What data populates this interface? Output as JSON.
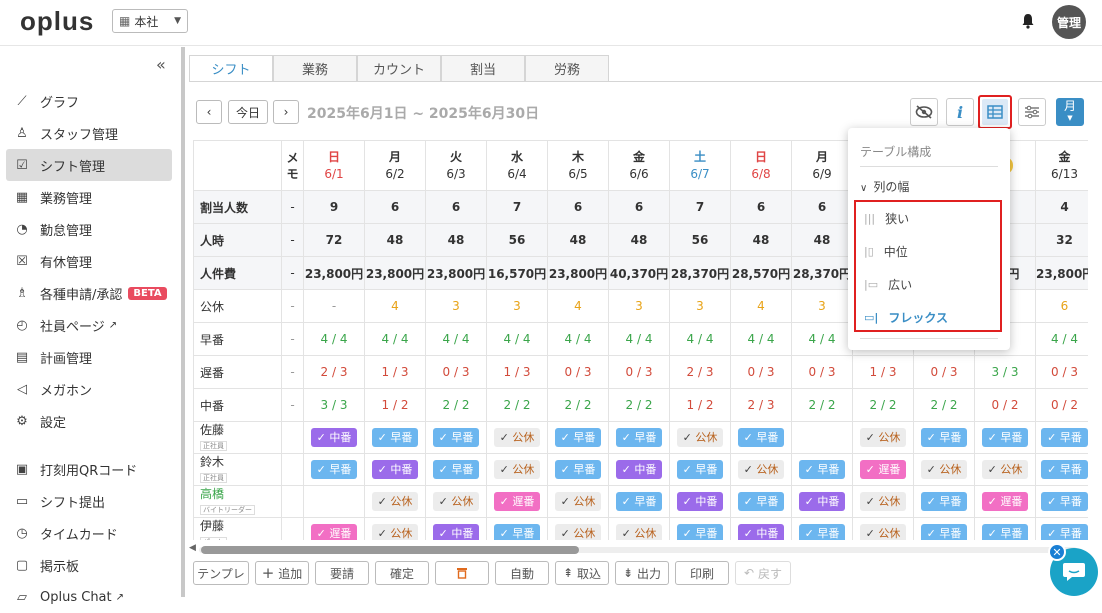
{
  "header": {
    "logo": "oplus",
    "office": "本社",
    "avatar": "管理"
  },
  "sidebar": {
    "items": [
      {
        "label": "グラフ",
        "icon": "chart-icon"
      },
      {
        "label": "スタッフ管理",
        "icon": "person-icon"
      },
      {
        "label": "シフト管理",
        "icon": "calendar-check-icon",
        "active": true
      },
      {
        "label": "業務管理",
        "icon": "calendar-tasks-icon"
      },
      {
        "label": "勤怠管理",
        "icon": "clock-icon"
      },
      {
        "label": "有休管理",
        "icon": "calendar-x-icon"
      },
      {
        "label": "各種申請/承認",
        "icon": "request-icon",
        "badge": "BETA"
      },
      {
        "label": "社員ページ",
        "icon": "stopwatch-icon",
        "external": true
      },
      {
        "label": "計画管理",
        "icon": "plan-icon"
      },
      {
        "label": "メガホン",
        "icon": "megaphone-icon"
      },
      {
        "label": "設定",
        "icon": "gear-icon"
      }
    ],
    "items2": [
      {
        "label": "打刻用QRコード",
        "icon": "qr-icon"
      },
      {
        "label": "シフト提出",
        "icon": "calendar-icon"
      },
      {
        "label": "タイムカード",
        "icon": "timecard-icon"
      },
      {
        "label": "掲示板",
        "icon": "board-icon"
      },
      {
        "label": "Oplus Chat",
        "icon": "chat-icon",
        "external": true
      }
    ]
  },
  "tabs": [
    "シフト",
    "業務",
    "カウント",
    "割当",
    "労務"
  ],
  "nav": {
    "today": "今日",
    "range": "2025年6月1日 ~ 2025年6月30日",
    "month": "月"
  },
  "table": {
    "memo_header": "メモ",
    "days": [
      {
        "dow": "日",
        "date": "6/1",
        "kind": "sun"
      },
      {
        "dow": "月",
        "date": "6/2",
        "kind": "wk"
      },
      {
        "dow": "火",
        "date": "6/3",
        "kind": "wk"
      },
      {
        "dow": "水",
        "date": "6/4",
        "kind": "wk"
      },
      {
        "dow": "木",
        "date": "6/5",
        "kind": "wk"
      },
      {
        "dow": "金",
        "date": "6/6",
        "kind": "wk"
      },
      {
        "dow": "土",
        "date": "6/7",
        "kind": "sat"
      },
      {
        "dow": "日",
        "date": "6/8",
        "kind": "sun"
      },
      {
        "dow": "月",
        "date": "6/9",
        "kind": "wk"
      },
      {
        "dow": "",
        "date": "",
        "kind": "wk"
      },
      {
        "dow": "",
        "date": "",
        "kind": "wk"
      },
      {
        "dow": "",
        "date": "2",
        "kind": "wk"
      },
      {
        "dow": "金",
        "date": "6/13",
        "kind": "wk"
      }
    ],
    "summary": [
      {
        "label": "割当人数",
        "memo": "-",
        "values": [
          "9",
          "6",
          "6",
          "7",
          "6",
          "6",
          "7",
          "6",
          "6",
          "",
          "",
          "",
          "4"
        ]
      },
      {
        "label": "人時",
        "memo": "-",
        "values": [
          "72",
          "48",
          "48",
          "56",
          "48",
          "48",
          "56",
          "48",
          "48",
          "",
          "",
          "5",
          "32"
        ]
      },
      {
        "label": "人件費",
        "memo": "-",
        "values": [
          "23,800円",
          "23,800円",
          "23,800円",
          "16,570円",
          "23,800円",
          "40,370円",
          "28,370円",
          "28,570円",
          "28,370円",
          "",
          "",
          "70円",
          "23,800円"
        ]
      }
    ],
    "counts": [
      {
        "label": "公休",
        "memo": "-",
        "color": "orange",
        "values": [
          "-",
          "4",
          "3",
          "3",
          "4",
          "3",
          "3",
          "4",
          "3",
          "",
          "",
          "",
          "6"
        ]
      },
      {
        "label": "早番",
        "memo": "-",
        "color": "green",
        "values": [
          "4 / 4",
          "4 / 4",
          "4 / 4",
          "4 / 4",
          "4 / 4",
          "4 / 4",
          "4 / 4",
          "4 / 4",
          "4 / 4",
          "",
          "",
          "",
          "4 / 4"
        ]
      },
      {
        "label": "遅番",
        "memo": "-",
        "color": "mixed",
        "values": [
          "2 / 3",
          "1 / 3",
          "0 / 3",
          "1 / 3",
          "0 / 3",
          "0 / 3",
          "2 / 3",
          "0 / 3",
          "0 / 3",
          "1 / 3",
          "0 / 3",
          "3 / 3",
          "0 / 3"
        ]
      },
      {
        "label": "中番",
        "memo": "-",
        "color": "mixed",
        "values": [
          "3 / 3",
          "1 / 2",
          "2 / 2",
          "2 / 2",
          "2 / 2",
          "2 / 2",
          "1 / 2",
          "2 / 3",
          "2 / 2",
          "2 / 2",
          "2 / 2",
          "0 / 2",
          "0 / 2"
        ]
      }
    ],
    "staff": [
      {
        "name": "佐藤",
        "role": "正社員",
        "shifts": [
          "中番",
          "早番",
          "早番",
          "公休",
          "早番",
          "早番",
          "公休",
          "早番",
          "",
          "公休",
          "早番",
          "早番",
          "早番"
        ]
      },
      {
        "name": "鈴木",
        "role": "正社員",
        "shifts": [
          "早番",
          "中番",
          "早番",
          "公休",
          "早番",
          "中番",
          "早番",
          "公休",
          "早番",
          "遅番",
          "公休",
          "公休",
          "早番"
        ]
      },
      {
        "name": "高橋",
        "role": "バイトリーダー",
        "shifts": [
          "",
          "公休",
          "公休",
          "遅番",
          "公休",
          "早番",
          "中番",
          "早番",
          "中番",
          "公休",
          "早番",
          "遅番",
          "早番"
        ]
      },
      {
        "name": "伊藤",
        "role": "パート",
        "shifts": [
          "遅番",
          "公休",
          "中番",
          "早番",
          "公休",
          "公休",
          "早番",
          "中番",
          "早番",
          "公休",
          "早番",
          "早番",
          "早番"
        ]
      }
    ]
  },
  "popup": {
    "title": "テーブル構成",
    "section": "列の幅",
    "options": [
      {
        "label": "狭い",
        "icon": "narrow-icon"
      },
      {
        "label": "中位",
        "icon": "medium-icon"
      },
      {
        "label": "広い",
        "icon": "wide-icon"
      },
      {
        "label": "フレックス",
        "icon": "flex-icon",
        "selected": true
      }
    ]
  },
  "bottom": {
    "buttons": [
      "テンプレ",
      "追加",
      "要請",
      "確定",
      "",
      "自動",
      "取込",
      "出力",
      "印刷",
      "戻す"
    ]
  },
  "colors": {
    "accent": "#3a8ec5",
    "early": "#6cb6ef",
    "mid": "#9b6bea",
    "late": "#f26fc4",
    "beta": "#e94b5f"
  }
}
